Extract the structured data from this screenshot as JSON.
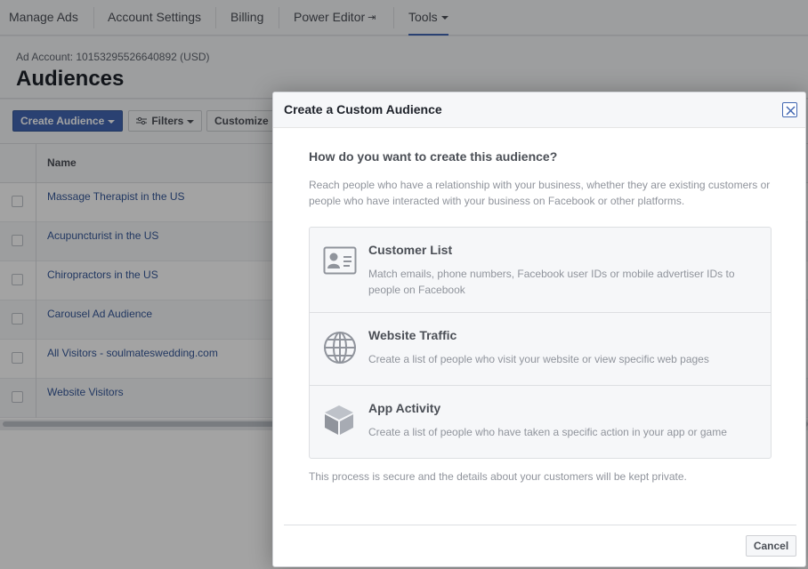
{
  "nav": {
    "items": [
      {
        "label": "Manage Ads"
      },
      {
        "label": "Account Settings"
      },
      {
        "label": "Billing"
      },
      {
        "label": "Power Editor"
      },
      {
        "label": "Tools"
      }
    ],
    "active": "Tools"
  },
  "header": {
    "account_id": "Ad Account: 10153295526640892 (USD)",
    "title": "Audiences"
  },
  "toolbar": {
    "create_label": "Create Audience",
    "filters_label": "Filters",
    "customize_label": "Customize"
  },
  "table": {
    "columns": [
      "Name"
    ],
    "rows": [
      {
        "name": "Massage Therapist in the US"
      },
      {
        "name": "Acupuncturist in the US"
      },
      {
        "name": "Chiropractors in the US"
      },
      {
        "name": "Carousel Ad Audience"
      },
      {
        "name": "All Visitors - soulmateswedding.com"
      },
      {
        "name": "Website Visitors"
      }
    ]
  },
  "dialog": {
    "title": "Create a Custom Audience",
    "question": "How do you want to create this audience?",
    "description": "Reach people who have a relationship with your business, whether they are existing customers or people who have interacted with your business on Facebook or other platforms.",
    "options": [
      {
        "title": "Customer List",
        "desc": "Match emails, phone numbers, Facebook user IDs or mobile advertiser IDs to people on Facebook",
        "icon": "contact-card-icon"
      },
      {
        "title": "Website Traffic",
        "desc": "Create a list of people who visit your website or view specific web pages",
        "icon": "globe-icon"
      },
      {
        "title": "App Activity",
        "desc": "Create a list of people who have taken a specific action in your app or game",
        "icon": "cube-icon"
      }
    ],
    "secure_note": "This process is secure and the details about your customers will be kept private.",
    "cancel_label": "Cancel"
  },
  "colors": {
    "accent": "#4267b2",
    "link": "#365899",
    "overlay": "rgba(0,0,0,0.36)"
  }
}
